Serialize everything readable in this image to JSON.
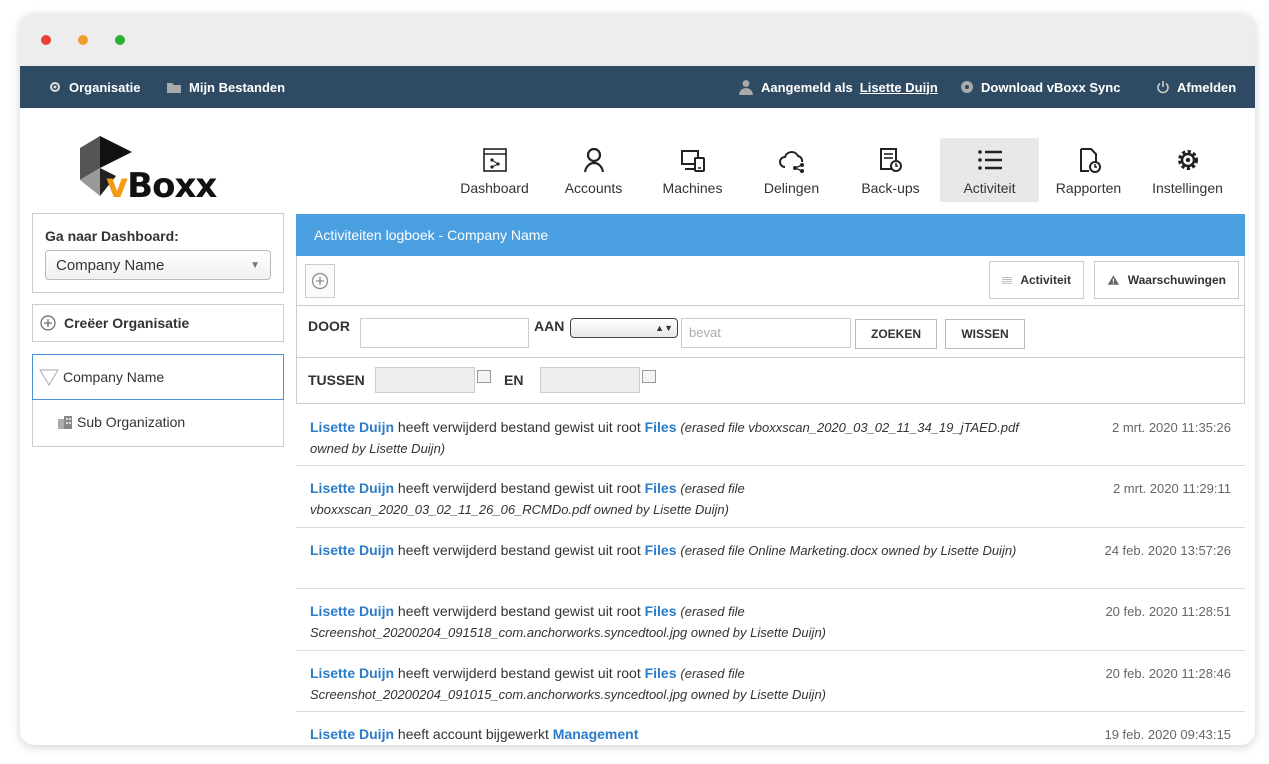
{
  "topnav": {
    "organisatie": "Organisatie",
    "mijn_bestanden": "Mijn Bestanden",
    "aangemeld_als": "Aangemeld als",
    "user": "Lisette Duijn",
    "download": "Download vBoxx Sync",
    "afmelden": "Afmelden"
  },
  "logo": {
    "v": "v",
    "rest": "Boxx"
  },
  "mainnav": [
    {
      "label": "Dashboard",
      "icon": "dashboard-icon"
    },
    {
      "label": "Accounts",
      "icon": "user-icon"
    },
    {
      "label": "Machines",
      "icon": "machines-icon"
    },
    {
      "label": "Delingen",
      "icon": "cloud-share-icon"
    },
    {
      "label": "Back-ups",
      "icon": "backup-icon"
    },
    {
      "label": "Activiteit",
      "icon": "list-icon"
    },
    {
      "label": "Rapporten",
      "icon": "report-icon"
    },
    {
      "label": "Instellingen",
      "icon": "gear-icon"
    }
  ],
  "sidebar": {
    "dashboard_label": "Ga naar Dashboard:",
    "dashboard_select": "Company Name",
    "create_org": "Creëer Organisatie",
    "org_name": "Company Name",
    "sub_org": "Sub Organization"
  },
  "panel": {
    "title": "Activiteiten logboek - Company Name",
    "activiteit_btn": "Activiteit",
    "waarschuwingen_btn": "Waarschuwingen",
    "door_label": "DOOR",
    "aan_label": "AAN",
    "bevat_placeholder": "bevat",
    "zoeken_btn": "ZOEKEN",
    "wissen_btn": "WISSEN",
    "tussen_label": "TUSSEN",
    "en_label": "EN"
  },
  "entries": [
    {
      "user": "Lisette Duijn",
      "action": " heeft verwijderd bestand gewist uit root ",
      "target": "Files",
      "detail": "(erased file vboxxscan_2020_03_02_11_34_19_jTAED.pdf owned by Lisette Duijn)",
      "time": "2 mrt. 2020 11:35:26"
    },
    {
      "user": "Lisette Duijn",
      "action": " heeft verwijderd bestand gewist uit root ",
      "target": "Files",
      "detail": "(erased file vboxxscan_2020_03_02_11_26_06_RCMDo.pdf owned by Lisette Duijn)",
      "time": "2 mrt. 2020 11:29:11"
    },
    {
      "user": "Lisette Duijn",
      "action": " heeft verwijderd bestand gewist uit root ",
      "target": "Files",
      "detail": "(erased file Online Marketing.docx owned by Lisette Duijn)",
      "time": "24 feb. 2020 13:57:26"
    },
    {
      "user": "Lisette Duijn",
      "action": " heeft verwijderd bestand gewist uit root ",
      "target": "Files",
      "detail": "(erased file Screenshot_20200204_091518_com.anchorworks.syncedtool.jpg owned by Lisette Duijn)",
      "time": "20 feb. 2020 11:28:51"
    },
    {
      "user": "Lisette Duijn",
      "action": " heeft verwijderd bestand gewist uit root ",
      "target": "Files",
      "detail": "(erased file Screenshot_20200204_091015_com.anchorworks.syncedtool.jpg owned by Lisette Duijn)",
      "time": "20 feb. 2020 11:28:46"
    },
    {
      "user": "Lisette Duijn",
      "action": " heeft account bijgewerkt ",
      "target": "Management",
      "detail": "",
      "time": "19 feb. 2020 09:43:15"
    }
  ],
  "colors": {
    "topnav_bg": "#2e4b63",
    "accent": "#4a9fe0",
    "link": "#2b7cc9",
    "logo_orange": "#f39c12"
  }
}
